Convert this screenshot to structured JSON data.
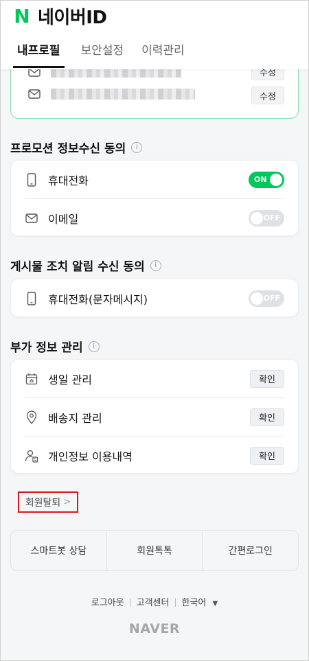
{
  "header": {
    "logo_letter": "N",
    "title": "네이버ID",
    "tabs": [
      {
        "label": "내프로필",
        "active": true
      },
      {
        "label": "보안설정",
        "active": false
      },
      {
        "label": "이력관리",
        "active": false
      }
    ]
  },
  "email_section": {
    "edit_label_top": "수정",
    "edit_label": "수정"
  },
  "promo": {
    "title": "프로모션 정보수신 동의",
    "items": [
      {
        "label": "휴대전화",
        "icon": "phone-icon",
        "toggle": "ON"
      },
      {
        "label": "이메일",
        "icon": "mail-icon",
        "toggle": "OFF"
      }
    ]
  },
  "post_notice": {
    "title": "게시물 조치 알림 수신 동의",
    "items": [
      {
        "label": "휴대전화(문자메시지)",
        "icon": "phone-icon",
        "toggle": "OFF"
      }
    ]
  },
  "extra_info": {
    "title": "부가 정보 관리",
    "items": [
      {
        "label": "생일 관리",
        "icon": "calendar-icon",
        "button": "확인"
      },
      {
        "label": "배송지 관리",
        "icon": "location-pin-icon",
        "button": "확인"
      },
      {
        "label": "개인정보 이용내역",
        "icon": "user-doc-icon",
        "button": "확인"
      }
    ]
  },
  "withdraw": {
    "label": "회원탈퇴",
    "chevron": ">"
  },
  "bottom_bar": [
    "스마트봇 상담",
    "회원톡톡",
    "간편로그인"
  ],
  "footer": {
    "links": [
      "로그아웃",
      "고객센터",
      "한국어"
    ],
    "brand": "NAVER"
  },
  "colors": {
    "accent": "#03c75a",
    "highlight_border": "#e0141e"
  }
}
